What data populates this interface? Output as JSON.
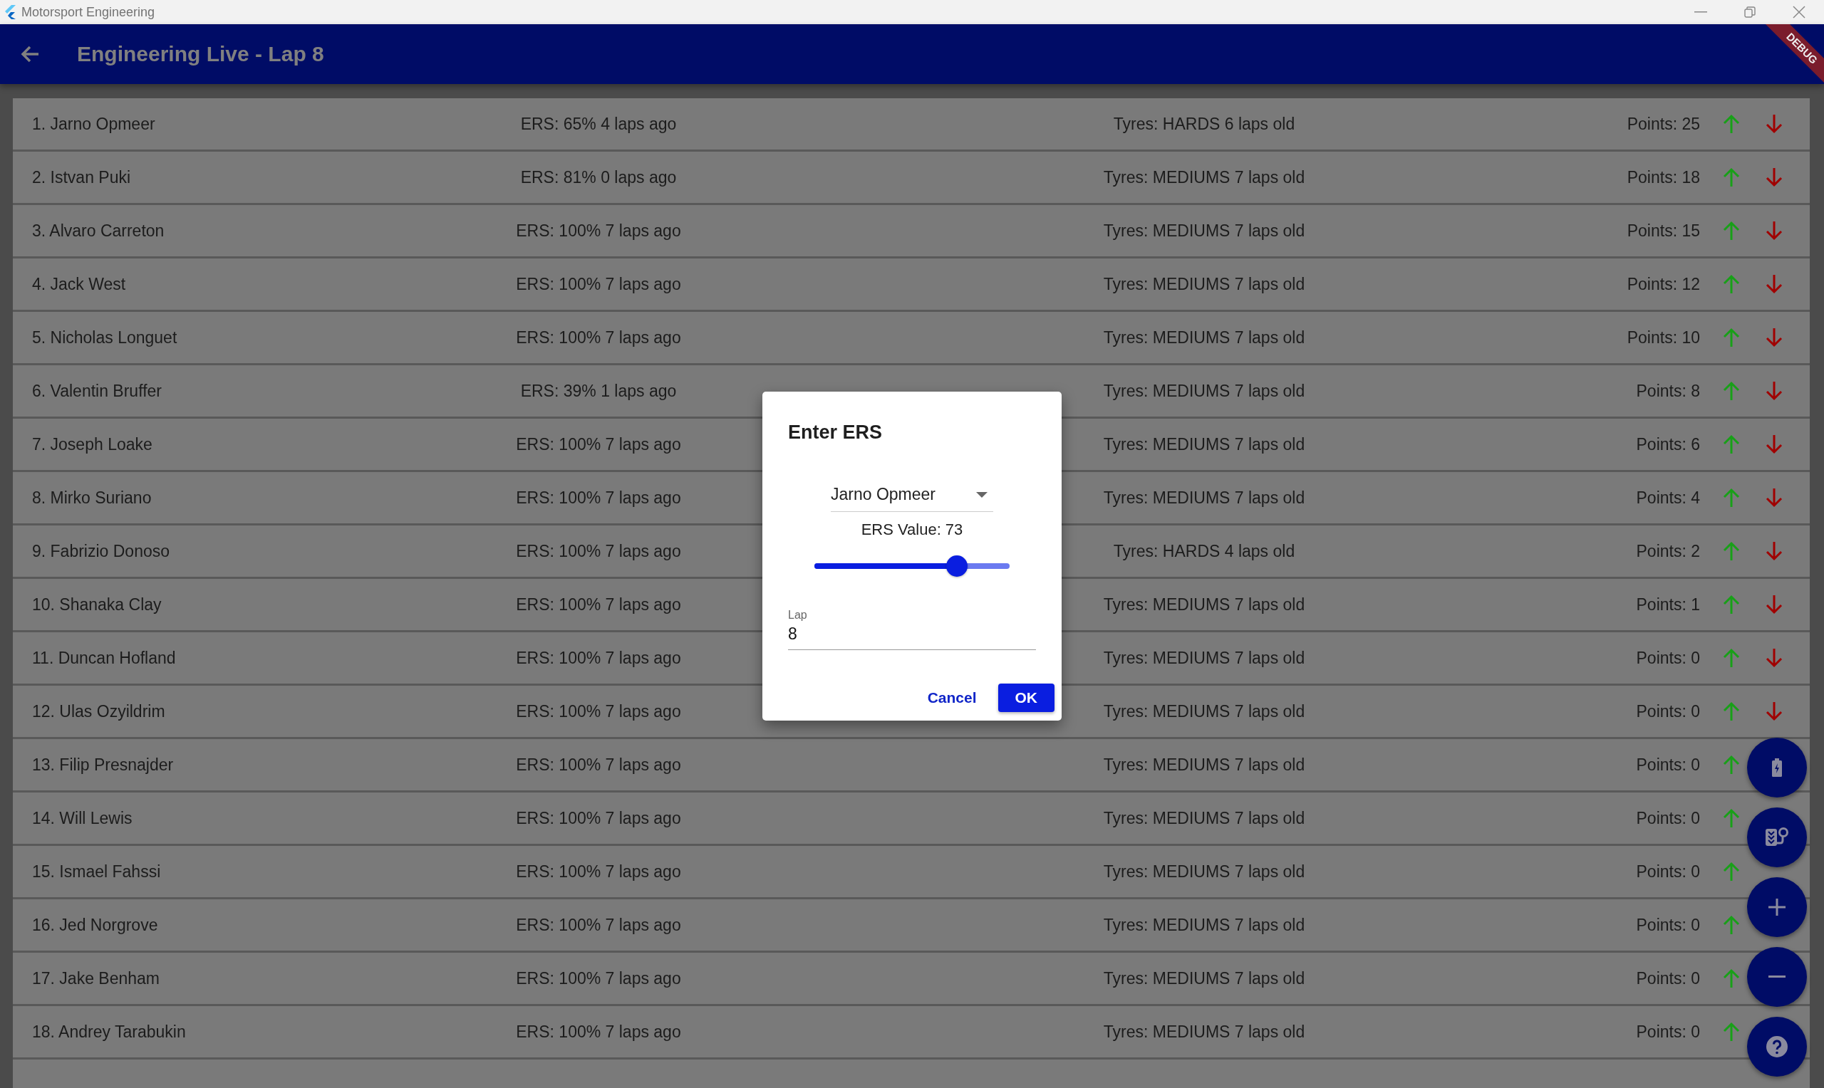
{
  "window": {
    "title": "Motorsport Engineering"
  },
  "app_bar": {
    "title": "Engineering Live - Lap 8",
    "banner": "DEBUG"
  },
  "drivers": [
    {
      "name": "1. Jarno Opmeer",
      "ers": "ERS: 65% 4 laps ago",
      "tyres": "Tyres: HARDS 6 laps old",
      "points": "Points: 25"
    },
    {
      "name": "2. Istvan Puki",
      "ers": "ERS: 81% 0 laps ago",
      "tyres": "Tyres: MEDIUMS 7 laps old",
      "points": "Points: 18"
    },
    {
      "name": "3. Alvaro Carreton",
      "ers": "ERS: 100% 7 laps ago",
      "tyres": "Tyres: MEDIUMS 7 laps old",
      "points": "Points: 15"
    },
    {
      "name": "4. Jack West",
      "ers": "ERS: 100% 7 laps ago",
      "tyres": "Tyres: MEDIUMS 7 laps old",
      "points": "Points: 12"
    },
    {
      "name": "5. Nicholas Longuet",
      "ers": "ERS: 100% 7 laps ago",
      "tyres": "Tyres: MEDIUMS 7 laps old",
      "points": "Points: 10"
    },
    {
      "name": "6. Valentin Bruffer",
      "ers": "ERS: 39% 1 laps ago",
      "tyres": "Tyres: MEDIUMS 7 laps old",
      "points": "Points: 8"
    },
    {
      "name": "7. Joseph Loake",
      "ers": "ERS: 100% 7 laps ago",
      "tyres": "Tyres: MEDIUMS 7 laps old",
      "points": "Points: 6"
    },
    {
      "name": "8. Mirko Suriano",
      "ers": "ERS: 100% 7 laps ago",
      "tyres": "Tyres: MEDIUMS 7 laps old",
      "points": "Points: 4"
    },
    {
      "name": "9. Fabrizio Donoso",
      "ers": "ERS: 100% 7 laps ago",
      "tyres": "Tyres: HARDS 4 laps old",
      "points": "Points: 2"
    },
    {
      "name": "10. Shanaka Clay",
      "ers": "ERS: 100% 7 laps ago",
      "tyres": "Tyres: MEDIUMS 7 laps old",
      "points": "Points: 1"
    },
    {
      "name": "11. Duncan Hofland",
      "ers": "ERS: 100% 7 laps ago",
      "tyres": "Tyres: MEDIUMS 7 laps old",
      "points": "Points: 0"
    },
    {
      "name": "12. Ulas Ozyildrim",
      "ers": "ERS: 100% 7 laps ago",
      "tyres": "Tyres: MEDIUMS 7 laps old",
      "points": "Points: 0"
    },
    {
      "name": "13. Filip Presnajder",
      "ers": "ERS: 100% 7 laps ago",
      "tyres": "Tyres: MEDIUMS 7 laps old",
      "points": "Points: 0"
    },
    {
      "name": "14. Will Lewis",
      "ers": "ERS: 100% 7 laps ago",
      "tyres": "Tyres: MEDIUMS 7 laps old",
      "points": "Points: 0"
    },
    {
      "name": "15. Ismael Fahssi",
      "ers": "ERS: 100% 7 laps ago",
      "tyres": "Tyres: MEDIUMS 7 laps old",
      "points": "Points: 0"
    },
    {
      "name": "16. Jed Norgrove",
      "ers": "ERS: 100% 7 laps ago",
      "tyres": "Tyres: MEDIUMS 7 laps old",
      "points": "Points: 0"
    },
    {
      "name": "17. Jake Benham",
      "ers": "ERS: 100% 7 laps ago",
      "tyres": "Tyres: MEDIUMS 7 laps old",
      "points": "Points: 0"
    },
    {
      "name": "18. Andrey Tarabukin",
      "ers": "ERS: 100% 7 laps ago",
      "tyres": "Tyres: MEDIUMS 7 laps old",
      "points": "Points: 0"
    }
  ],
  "dialog": {
    "title": "Enter ERS",
    "driver": "Jarno Opmeer",
    "ers_label": "ERS Value: 73",
    "ers_slider": {
      "level": 0.73
    },
    "lap": {
      "label": "Lap",
      "value": "8"
    },
    "buttons": [
      {
        "label": "Cancel",
        "kind": "text"
      },
      {
        "label": "OK",
        "kind": "filled"
      }
    ]
  }
}
